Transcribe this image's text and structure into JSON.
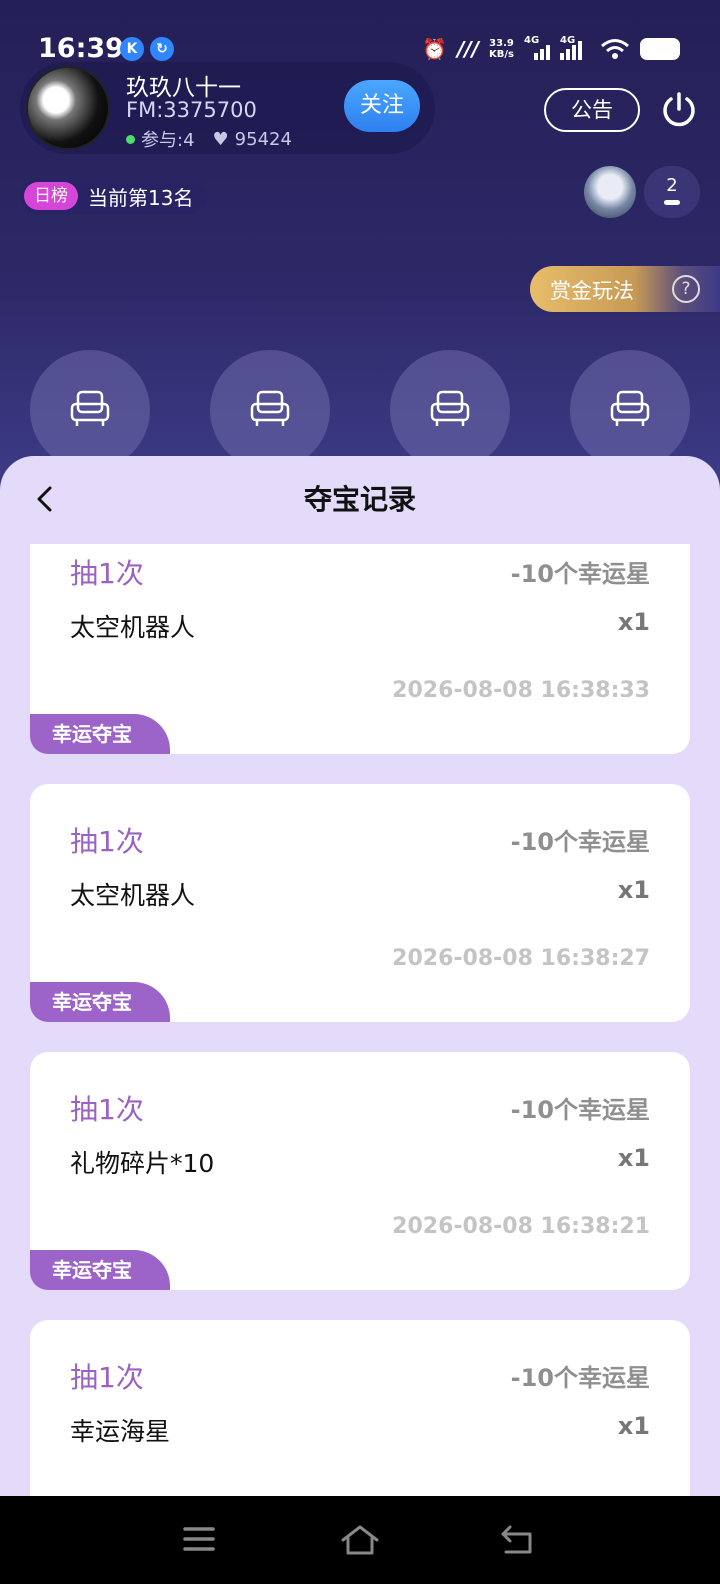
{
  "status_bar": {
    "time": "16:39",
    "speed_top": "33.9",
    "speed_bottom": "KB/s",
    "net1": "4G",
    "net2": "4G"
  },
  "host": {
    "name": "玖玖八十一",
    "fm": "FM:3375700",
    "participants": "参与:4",
    "likes": "95424",
    "follow_label": "关注"
  },
  "header": {
    "notice_label": "公告",
    "rank_badge": "日榜",
    "rank_text": "当前第13名",
    "viewer_count": "2",
    "bounty_label": "赏金玩法",
    "help_glyph": "?"
  },
  "sheet": {
    "title": "夺宝记录"
  },
  "records": [
    {
      "draw": "抽1次",
      "cost": "-10个幸运星",
      "prize": "太空机器人",
      "qty": "x1",
      "time": "2026-08-08 16:38:33",
      "tag": "幸运夺宝"
    },
    {
      "draw": "抽1次",
      "cost": "-10个幸运星",
      "prize": "太空机器人",
      "qty": "x1",
      "time": "2026-08-08 16:38:27",
      "tag": "幸运夺宝"
    },
    {
      "draw": "抽1次",
      "cost": "-10个幸运星",
      "prize": "礼物碎片*10",
      "qty": "x1",
      "time": "2026-08-08 16:38:21",
      "tag": "幸运夺宝"
    },
    {
      "draw": "抽1次",
      "cost": "-10个幸运星",
      "prize": "幸运海星",
      "qty": "x1",
      "time": "",
      "tag": ""
    }
  ],
  "colors": {
    "accent_purple": "#9c64c9",
    "follow_blue": "#3a8ff6",
    "sheet_bg": "#e4dbfb"
  }
}
